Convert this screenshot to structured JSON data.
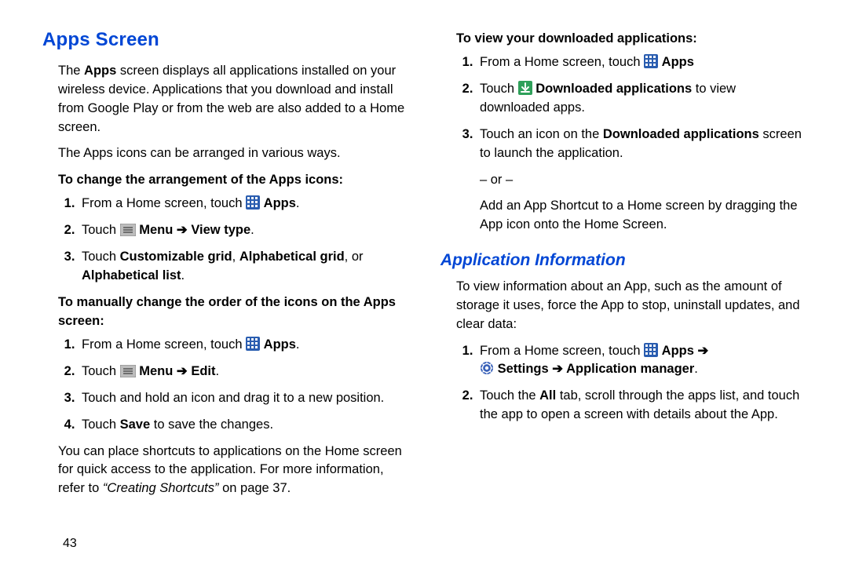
{
  "headings": {
    "apps_screen": "Apps Screen",
    "application_information": "Application Information"
  },
  "left": {
    "intro1_lead": "The ",
    "intro1_apps": "Apps",
    "intro1_tail": " screen displays all applications installed on your wireless device. Applications that you download and install from Google Play or from the web are also added to a Home screen.",
    "intro2": "The Apps icons can be arranged in various ways.",
    "sub_change": "To change the arrangement of the Apps icons:",
    "s1_lead": "From a Home screen, touch ",
    "s1_apps": "Apps",
    "s2_lead": "Touch ",
    "s2_menu": "Menu",
    "s2_arrow": " ➔ ",
    "s2_view": "View type",
    "s3_pre": "Touch ",
    "s3_cg": "Customizable grid",
    "s3_c1": ", ",
    "s3_ag": "Alphabetical grid",
    "s3_c2": ", or ",
    "s3_al": "Alphabetical list",
    "sub_manual": "To manually change the order of the icons on the Apps screen:",
    "m1_lead": "From a Home screen, touch ",
    "m1_apps": "Apps",
    "m2_lead": "Touch ",
    "m2_menu": "Menu",
    "m2_arrow": " ➔ ",
    "m2_edit": "Edit",
    "m3": "Touch and hold an icon and drag it to a new position.",
    "m4_lead": "Touch ",
    "m4_save": "Save",
    "m4_tail": " to save the changes.",
    "shortcut_lead": "You can place shortcuts to applications on the Home screen for quick access to the application. For more information, refer to ",
    "shortcut_ref": "“Creating Shortcuts”",
    "shortcut_tail": " on page 37.",
    "page_number": "43"
  },
  "right": {
    "sub_download": "To view your downloaded applications:",
    "d1_lead": "From a Home screen, touch ",
    "d1_apps": "Apps",
    "d2_lead": "Touch ",
    "d2_dl": "Downloaded applications",
    "d2_tail": " to view downloaded apps.",
    "d3_lead": "Touch an icon on the ",
    "d3_da": "Downloaded applications",
    "d3_tail": " screen to launch the application.",
    "or": "– or –",
    "after_or": "Add an App Shortcut to a Home screen by dragging the App icon onto the Home Screen.",
    "info_intro": "To view information about an App, such as the amount of storage it uses, force the App to stop, uninstall updates, and clear data:",
    "i1_lead": "From a Home screen, touch ",
    "i1_apps": "Apps",
    "i1_arrow1": " ➔ ",
    "i1_settings": "Settings",
    "i1_arrow2": " ➔ ",
    "i1_appmgr": "Application manager",
    "i2_lead": "Touch the ",
    "i2_all": "All",
    "i2_tail": " tab, scroll through the apps list, and touch the app to open a screen with details about the App."
  }
}
